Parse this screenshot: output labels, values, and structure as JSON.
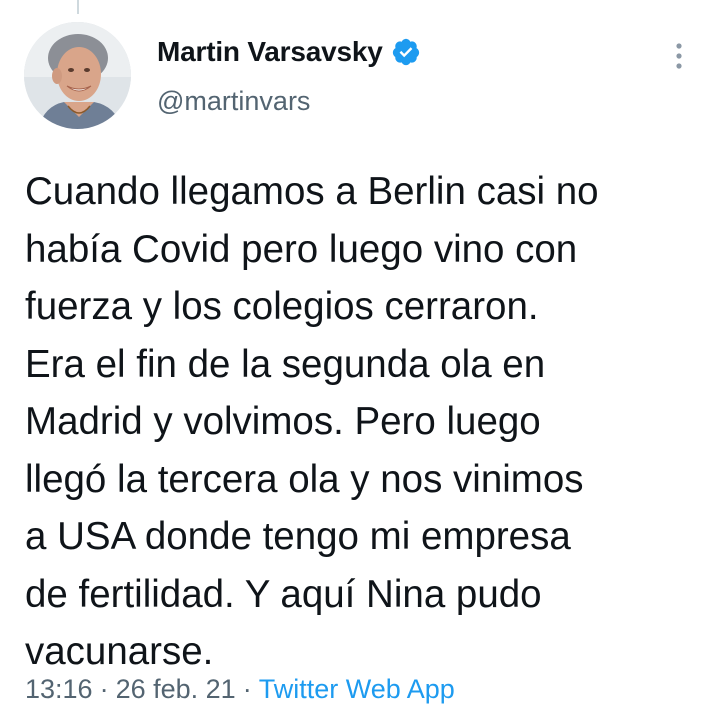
{
  "author": {
    "display_name": "Martin Varsavsky",
    "handle": "@martinvars",
    "verified": true,
    "avatar_icon": "profile-photo"
  },
  "tweet": {
    "lines": [
      "Cuando llegamos a Berlin casi no",
      "había Covid pero luego vino con",
      "fuerza y los colegios cerraron.",
      "Era el fin de la segunda ola en",
      "Madrid y volvimos. Pero luego",
      "llegó la tercera ola y nos vinimos",
      "a USA donde tengo mi empresa",
      "de fertilidad. Y aquí Nina pudo",
      "vacunarse."
    ]
  },
  "meta": {
    "time": "13:16",
    "separator": "·",
    "date": "26 feb. 21",
    "source": "Twitter Web App"
  },
  "colors": {
    "text": "#0f1419",
    "secondary": "#536471",
    "accent": "#1d9bf0"
  },
  "icons": {
    "verified": "verified-badge-icon",
    "more": "more-vertical-icon"
  }
}
